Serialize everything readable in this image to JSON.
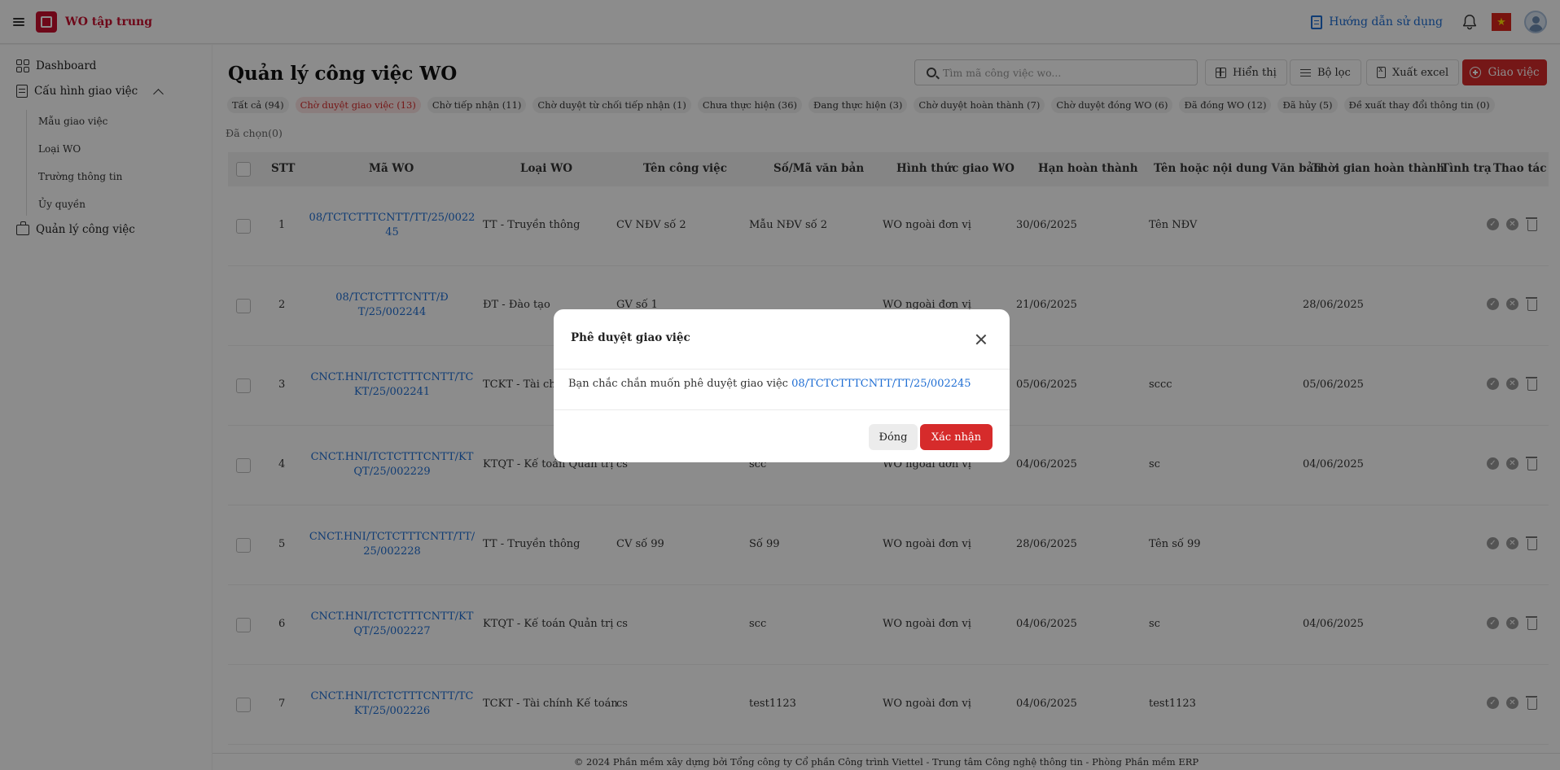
{
  "app": {
    "title": "WO tập trung",
    "guide_label": "Hướng dẫn sử dụng",
    "flag_icon": "vietnam-flag-icon"
  },
  "sidebar": {
    "dashboard": "Dashboard",
    "config": "Cấu hình giao việc",
    "config_items": [
      "Mẫu giao việc",
      "Loại WO",
      "Trường thông tin",
      "Ủy quyền"
    ],
    "manage": "Quản lý công việc"
  },
  "main": {
    "title": "Quản lý công việc WO",
    "search_placeholder": "Tìm mã công việc wo...",
    "btn_display": "Hiển thị",
    "btn_filter": "Bộ lọc",
    "btn_excel": "Xuất excel",
    "btn_assign": "Giao việc",
    "selected": "Đã chọn(0)"
  },
  "tabs": [
    "Tất cả (94)",
    "Chờ duyệt giao việc (13)",
    "Chờ tiếp nhận (11)",
    "Chờ duyệt từ chối tiếp nhận (1)",
    "Chưa thực hiện (36)",
    "Đang thực hiện (3)",
    "Chờ duyệt hoàn thành (7)",
    "Chờ duyệt đóng WO (6)",
    "Đã đóng WO (12)",
    "Đã hủy (5)",
    "Đề xuất thay đổi thông tin (0)"
  ],
  "table": {
    "headers": [
      "STT",
      "Mã WO",
      "Loại WO",
      "Tên công việc",
      "Số/Mã văn bản",
      "Hình thức giao WO",
      "Hạn hoàn thành",
      "Tên hoặc nội dung Văn bản",
      "Thời gian hoàn thành",
      "Tình trạ",
      "Thao tác"
    ],
    "rows": [
      {
        "stt": "1",
        "code": "08/TCTCTTTCNTT/TT/25/002245",
        "type": "TT - Truyền thông",
        "name": "CV NĐV số 2",
        "doc_no": "Mẫu NĐV số 2",
        "form": "WO ngoài đơn vị",
        "due": "30/06/2025",
        "content": "Tên NĐV",
        "done": ""
      },
      {
        "stt": "2",
        "code": "08/TCTCTTTCNTT/ĐT/25/002244",
        "type": "ĐT - Đào tạo",
        "name": "GV số 1",
        "doc_no": "",
        "form": "WO ngoài đơn vị",
        "due": "21/06/2025",
        "content": "",
        "done": "28/06/2025"
      },
      {
        "stt": "3",
        "code": "CNCT.HNI/TCTCTTTCNTT/TCKT/25/002241",
        "type": "TCKT - Tài chính Kế toán",
        "name": "",
        "doc_no": "",
        "form": "",
        "due": "05/06/2025",
        "content": "sccc",
        "done": "05/06/2025"
      },
      {
        "stt": "4",
        "code": "CNCT.HNI/TCTCTTTCNTT/KTQT/25/002229",
        "type": "KTQT - Kế toán Quản trị",
        "name": "cs",
        "doc_no": "scc",
        "form": "WO ngoài đơn vị",
        "due": "04/06/2025",
        "content": "sc",
        "done": "04/06/2025"
      },
      {
        "stt": "5",
        "code": "CNCT.HNI/TCTCTTTCNTT/TT/25/002228",
        "type": "TT - Truyền thông",
        "name": "CV số 99",
        "doc_no": "Số 99",
        "form": "WO ngoài đơn vị",
        "due": "28/06/2025",
        "content": "Tên số 99",
        "done": ""
      },
      {
        "stt": "6",
        "code": "CNCT.HNI/TCTCTTTCNTT/KTQT/25/002227",
        "type": "KTQT - Kế toán Quản trị",
        "name": "cs",
        "doc_no": "scc",
        "form": "WO ngoài đơn vị",
        "due": "04/06/2025",
        "content": "sc",
        "done": "04/06/2025"
      },
      {
        "stt": "7",
        "code": "CNCT.HNI/TCTCTTTCNTT/TCKT/25/002226",
        "type": "TCKT - Tài chính Kế toán",
        "name": "cs",
        "doc_no": "test1123",
        "form": "WO ngoài đơn vị",
        "due": "04/06/2025",
        "content": "test1123",
        "done": ""
      }
    ]
  },
  "footer": "© 2024 Phần mềm xây dựng bởi Tổng công ty Cổ phần Công trình Viettel - Trung tâm Công nghệ thông tin - Phòng Phần mềm ERP",
  "modal": {
    "title": "Phê duyệt giao việc",
    "message": "Bạn chắc chắn muốn phê duyệt giao việc",
    "code": "08/TCTCTTTCNTT/TT/25/002245",
    "btn_close": "Đóng",
    "btn_confirm": "Xác nhận"
  },
  "colors": {
    "accent": "#d62b2b",
    "link": "#1e6dd3"
  }
}
